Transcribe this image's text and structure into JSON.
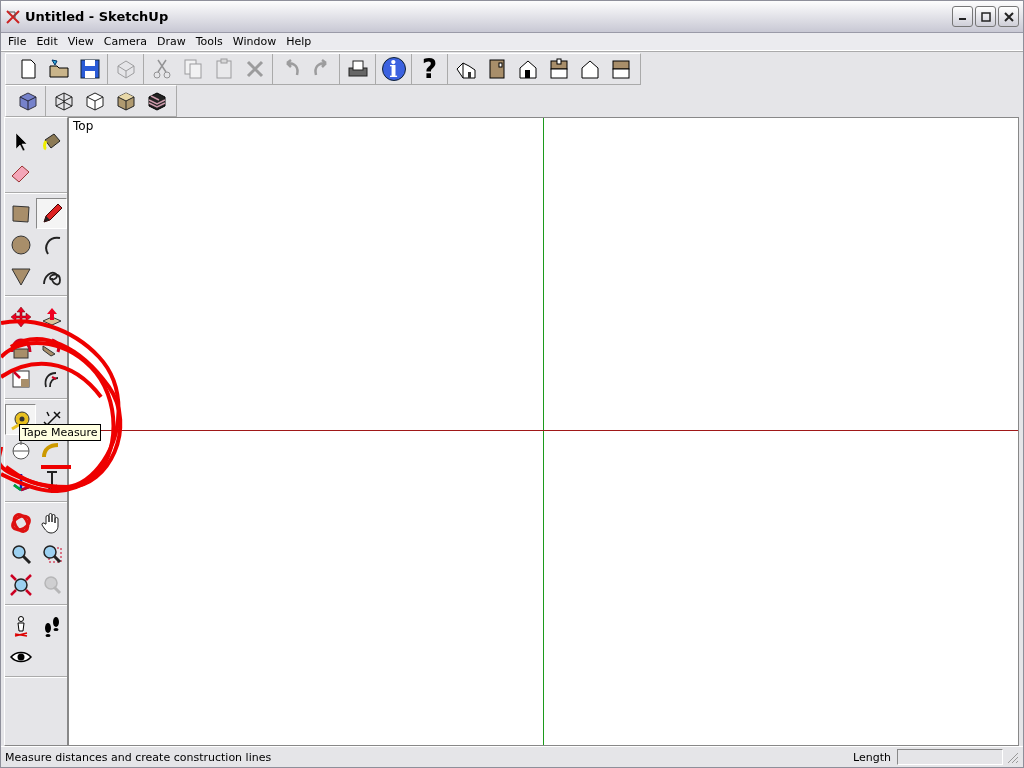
{
  "window": {
    "title": "Untitled - SketchUp"
  },
  "menu": [
    "File",
    "Edit",
    "View",
    "Camera",
    "Draw",
    "Tools",
    "Window",
    "Help"
  ],
  "toolbars": [
    {
      "groups": [
        [
          {
            "kind": "new",
            "disabled": false
          },
          {
            "kind": "open",
            "disabled": false
          },
          {
            "kind": "save",
            "disabled": false
          }
        ],
        [
          {
            "kind": "component",
            "disabled": true
          }
        ],
        [
          {
            "kind": "cut",
            "disabled": true
          },
          {
            "kind": "copy",
            "disabled": true
          },
          {
            "kind": "paste",
            "disabled": true
          },
          {
            "kind": "delete",
            "disabled": true
          }
        ],
        [
          {
            "kind": "undo",
            "disabled": true
          },
          {
            "kind": "redo",
            "disabled": true
          }
        ],
        [
          {
            "kind": "print",
            "disabled": false
          }
        ],
        [
          {
            "kind": "info",
            "glyph": "i",
            "disabled": false
          }
        ],
        [
          {
            "kind": "help",
            "glyph": "?",
            "disabled": false
          }
        ],
        [
          {
            "kind": "view-iso",
            "disabled": false
          },
          {
            "kind": "view-right",
            "disabled": false
          },
          {
            "kind": "view-front",
            "disabled": false
          },
          {
            "kind": "view-top",
            "disabled": false
          },
          {
            "kind": "view-back",
            "disabled": false
          },
          {
            "kind": "view-left",
            "disabled": false
          }
        ]
      ]
    },
    {
      "groups": [
        [
          {
            "kind": "xray",
            "disabled": false
          }
        ],
        [
          {
            "kind": "wireframe",
            "disabled": false
          },
          {
            "kind": "hidden",
            "disabled": false
          },
          {
            "kind": "shaded",
            "disabled": false
          },
          {
            "kind": "textured",
            "disabled": false
          }
        ]
      ]
    }
  ],
  "tool_palette": {
    "groups": [
      [
        {
          "kind": "select",
          "selected": false,
          "disabled": false
        },
        {
          "kind": "paint",
          "selected": false,
          "disabled": false
        },
        {
          "kind": "eraser",
          "selected": false,
          "disabled": false
        }
      ],
      [
        {
          "kind": "rectangle",
          "selected": false,
          "disabled": false
        },
        {
          "kind": "pencil",
          "selected": true,
          "disabled": false
        },
        {
          "kind": "circle",
          "selected": false,
          "disabled": false
        },
        {
          "kind": "arc",
          "selected": false,
          "disabled": false
        },
        {
          "kind": "polygon",
          "selected": false,
          "disabled": false
        },
        {
          "kind": "freehand",
          "selected": false,
          "disabled": false
        }
      ],
      [
        {
          "kind": "move",
          "selected": false,
          "disabled": false
        },
        {
          "kind": "pushpull",
          "selected": false,
          "disabled": false
        },
        {
          "kind": "rotate",
          "selected": false,
          "disabled": false
        },
        {
          "kind": "followme",
          "selected": false,
          "disabled": false
        },
        {
          "kind": "scale",
          "selected": false,
          "disabled": false
        },
        {
          "kind": "offset",
          "selected": false,
          "disabled": false
        }
      ],
      [
        {
          "kind": "tape",
          "selected": true,
          "disabled": false
        },
        {
          "kind": "dimension",
          "selected": false,
          "disabled": false
        },
        {
          "kind": "protractor",
          "selected": false,
          "disabled": false
        },
        {
          "kind": "text",
          "selected": false,
          "disabled": false
        },
        {
          "kind": "axes",
          "selected": false,
          "disabled": false
        },
        {
          "kind": "text3d",
          "selected": false,
          "disabled": false
        }
      ],
      [
        {
          "kind": "orbit",
          "selected": false,
          "disabled": false
        },
        {
          "kind": "pan",
          "selected": false,
          "disabled": false
        },
        {
          "kind": "zoom",
          "selected": false,
          "disabled": false
        },
        {
          "kind": "zoomwindow",
          "selected": false,
          "disabled": false
        },
        {
          "kind": "zoomextents",
          "selected": false,
          "disabled": false
        },
        {
          "kind": "previous",
          "selected": false,
          "disabled": true
        }
      ],
      [
        {
          "kind": "camera",
          "selected": false,
          "disabled": false
        },
        {
          "kind": "walk",
          "selected": false,
          "disabled": false
        },
        {
          "kind": "look",
          "selected": false,
          "disabled": false
        }
      ]
    ]
  },
  "viewport": {
    "label": "Top"
  },
  "tooltip": {
    "text": "Tape Measure"
  },
  "status_bar": {
    "hint": "Measure distances and create construction lines",
    "measure_label": "Length"
  }
}
